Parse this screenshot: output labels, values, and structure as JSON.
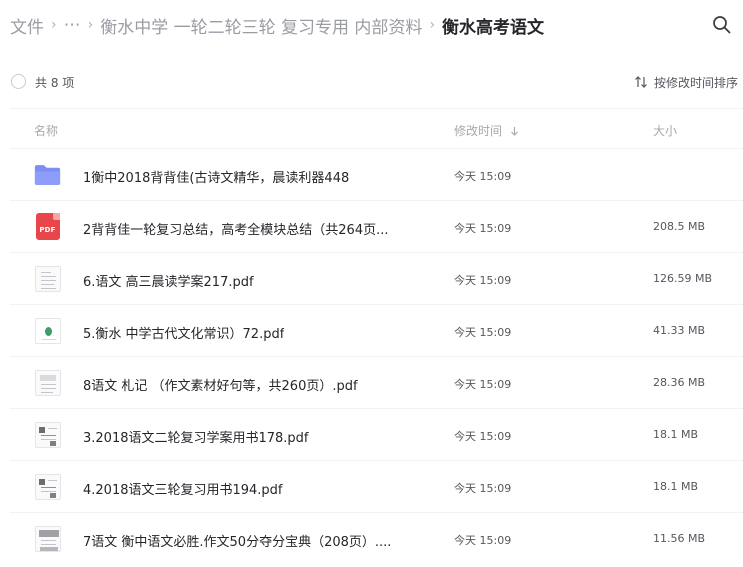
{
  "breadcrumb": {
    "items": [
      "文件",
      "⋯",
      "衡水中学 一轮二轮三轮 复习专用 内部资料"
    ],
    "current": "衡水高考语文",
    "separator": "›"
  },
  "toolbar": {
    "count_label": "共 8 项",
    "sort_label": "按修改时间排序"
  },
  "columns": {
    "name": "名称",
    "mtime": "修改时间",
    "size": "大小"
  },
  "files": [
    {
      "name": "1衡中2018背背佳(古诗文精华，晨读利器448",
      "time": "今天 15:09",
      "size": "",
      "icon": "folder-icon"
    },
    {
      "name": "2背背佳一轮复习总结，高考全模块总结（共264页...",
      "time": "今天 15:09",
      "size": "208.5 MB",
      "icon": "pdf-icon"
    },
    {
      "name": "6.语文 高三晨读学案217.pdf",
      "time": "今天 15:09",
      "size": "126.59 MB",
      "icon": "document-thumbnail"
    },
    {
      "name": "5.衡水 中学古代文化常识）72.pdf",
      "time": "今天 15:09",
      "size": "41.33 MB",
      "icon": "document-thumbnail"
    },
    {
      "name": "8语文 札记 （作文素材好句等，共260页）.pdf",
      "time": "今天 15:09",
      "size": "28.36 MB",
      "icon": "document-thumbnail"
    },
    {
      "name": "3.2018语文二轮复习学案用书178.pdf",
      "time": "今天 15:09",
      "size": "18.1 MB",
      "icon": "document-thumbnail"
    },
    {
      "name": "4.2018语文三轮复习用书194.pdf",
      "time": "今天 15:09",
      "size": "18.1 MB",
      "icon": "document-thumbnail"
    },
    {
      "name": "7语文 衡中语文必胜.作文50分夺分宝典（208页）....",
      "time": "今天 15:09",
      "size": "11.56 MB",
      "icon": "document-thumbnail"
    }
  ],
  "pdf_badge_text": "PDF",
  "colors": {
    "folder": "#7a8ef5",
    "pdf": "#e8464a",
    "text": "#25262b",
    "muted": "#9a9ca3"
  }
}
